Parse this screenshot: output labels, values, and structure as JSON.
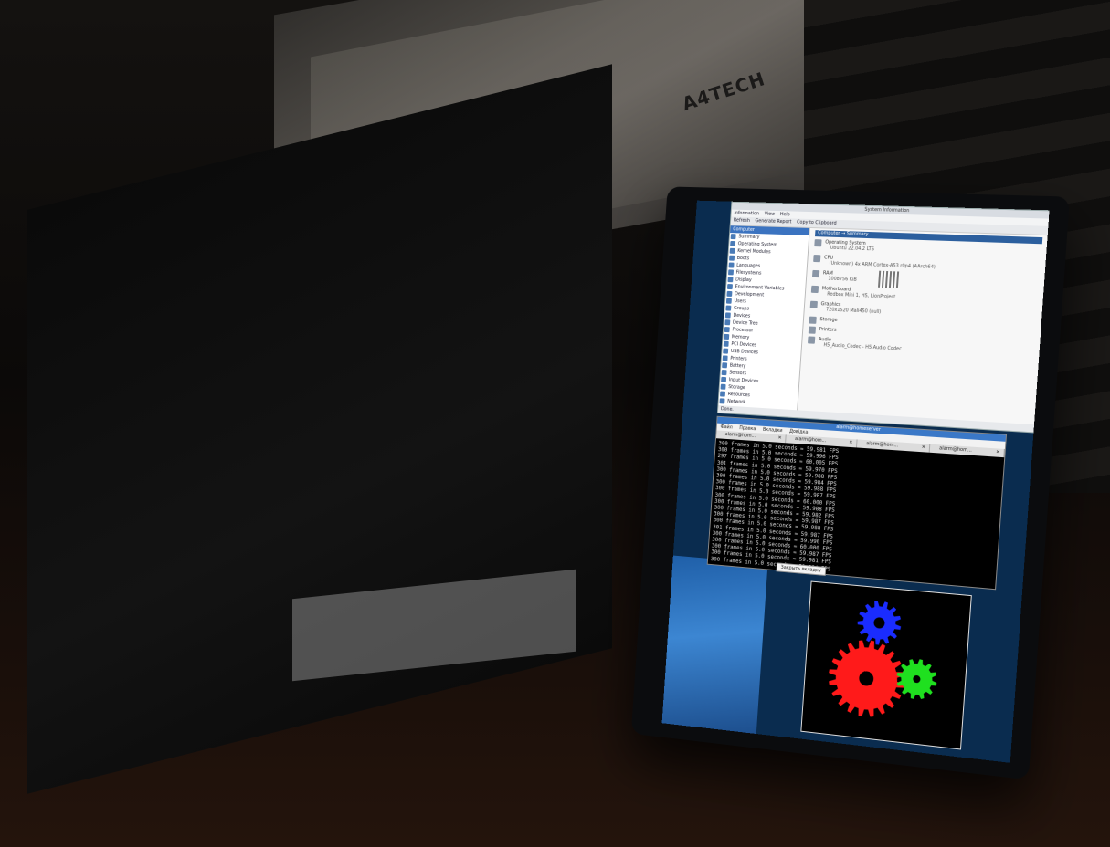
{
  "photo": {
    "keyboard_brand": "A4TECH",
    "sysinfo_window": {
      "title": "System Information",
      "menu": [
        "Information",
        "View",
        "Help"
      ],
      "toolbar": [
        "Refresh",
        "Generate Report",
        "Copy to Clipboard"
      ],
      "sidebar_header": "Computer",
      "sidebar_items": [
        "Summary",
        "Operating System",
        "Kernel Modules",
        "Boots",
        "Languages",
        "Filesystems",
        "Display",
        "Environment Variables",
        "Development",
        "Users",
        "Groups",
        "Devices",
        "Device Tree",
        "Processor",
        "Memory",
        "PCI Devices",
        "USB Devices",
        "Printers",
        "Battery",
        "Sensors",
        "Input Devices",
        "Storage",
        "Resources",
        "Network"
      ],
      "main_header": "Computer → Summary",
      "sections": [
        {
          "title": "Operating System",
          "value": "Ubuntu 22.04.2 LTS"
        },
        {
          "title": "CPU",
          "value": "(Unknown) 4x ARM Cortex-A53 r0p4 (AArch64)"
        },
        {
          "title": "RAM",
          "value": "1008756 KiB"
        },
        {
          "title": "Motherboard",
          "value": "Redbox Mini 1, H5, LionProject"
        },
        {
          "title": "Graphics",
          "value": "720x1520 Mali450 (null)"
        },
        {
          "title": "Storage",
          "value": ""
        },
        {
          "title": "Printers",
          "value": ""
        },
        {
          "title": "Audio",
          "value": "H5_Audio_Codec - H5 Audio Codec"
        }
      ],
      "status": "Done."
    },
    "terminal": {
      "title": "alarm@homeserver",
      "menu": [
        "Файл",
        "Правка",
        "Вкладки",
        "Довідка"
      ],
      "tabs": [
        "alarm@hom...",
        "alarm@hom...",
        "alarm@hom...",
        "alarm@hom..."
      ],
      "lines": [
        "300 frames in 5.0 seconds = 59.981 FPS",
        "300 frames in 5.0 seconds = 59.996 FPS",
        "297 frames in 5.0 seconds = 60.005 FPS",
        "301 frames in 5.0 seconds = 59.970 FPS",
        "300 frames in 5.0 seconds = 59.988 FPS",
        "300 frames in 5.0 seconds = 59.984 FPS",
        "300 frames in 5.0 seconds = 59.988 FPS",
        "300 frames in 5.0 seconds = 59.987 FPS",
        "300 frames in 5.0 seconds = 60.000 FPS",
        "300 frames in 5.0 seconds = 59.988 FPS",
        "300 frames in 5.0 seconds = 59.982 FPS",
        "300 frames in 5.0 seconds = 59.987 FPS",
        "300 frames in 5.0 seconds = 59.988 FPS",
        "301 frames in 5.0 seconds = 59.987 FPS",
        "300 frames in 5.0 seconds = 59.990 FPS",
        "300 frames in 5.0 seconds = 60.000 FPS",
        "300 frames in 5.0 seconds = 59.987 FPS",
        "300 frames in 5.0 seconds = 59.981 FPS",
        "300 frames in 5.0 seconds = 59.984 FPS"
      ]
    },
    "tooltip": "Закрыть вкладку",
    "colors": {
      "gear_red": "#ff1a1a",
      "gear_green": "#1fe01f",
      "gear_blue": "#1a2cff",
      "desktop_blue": "#2a6fc0"
    }
  }
}
